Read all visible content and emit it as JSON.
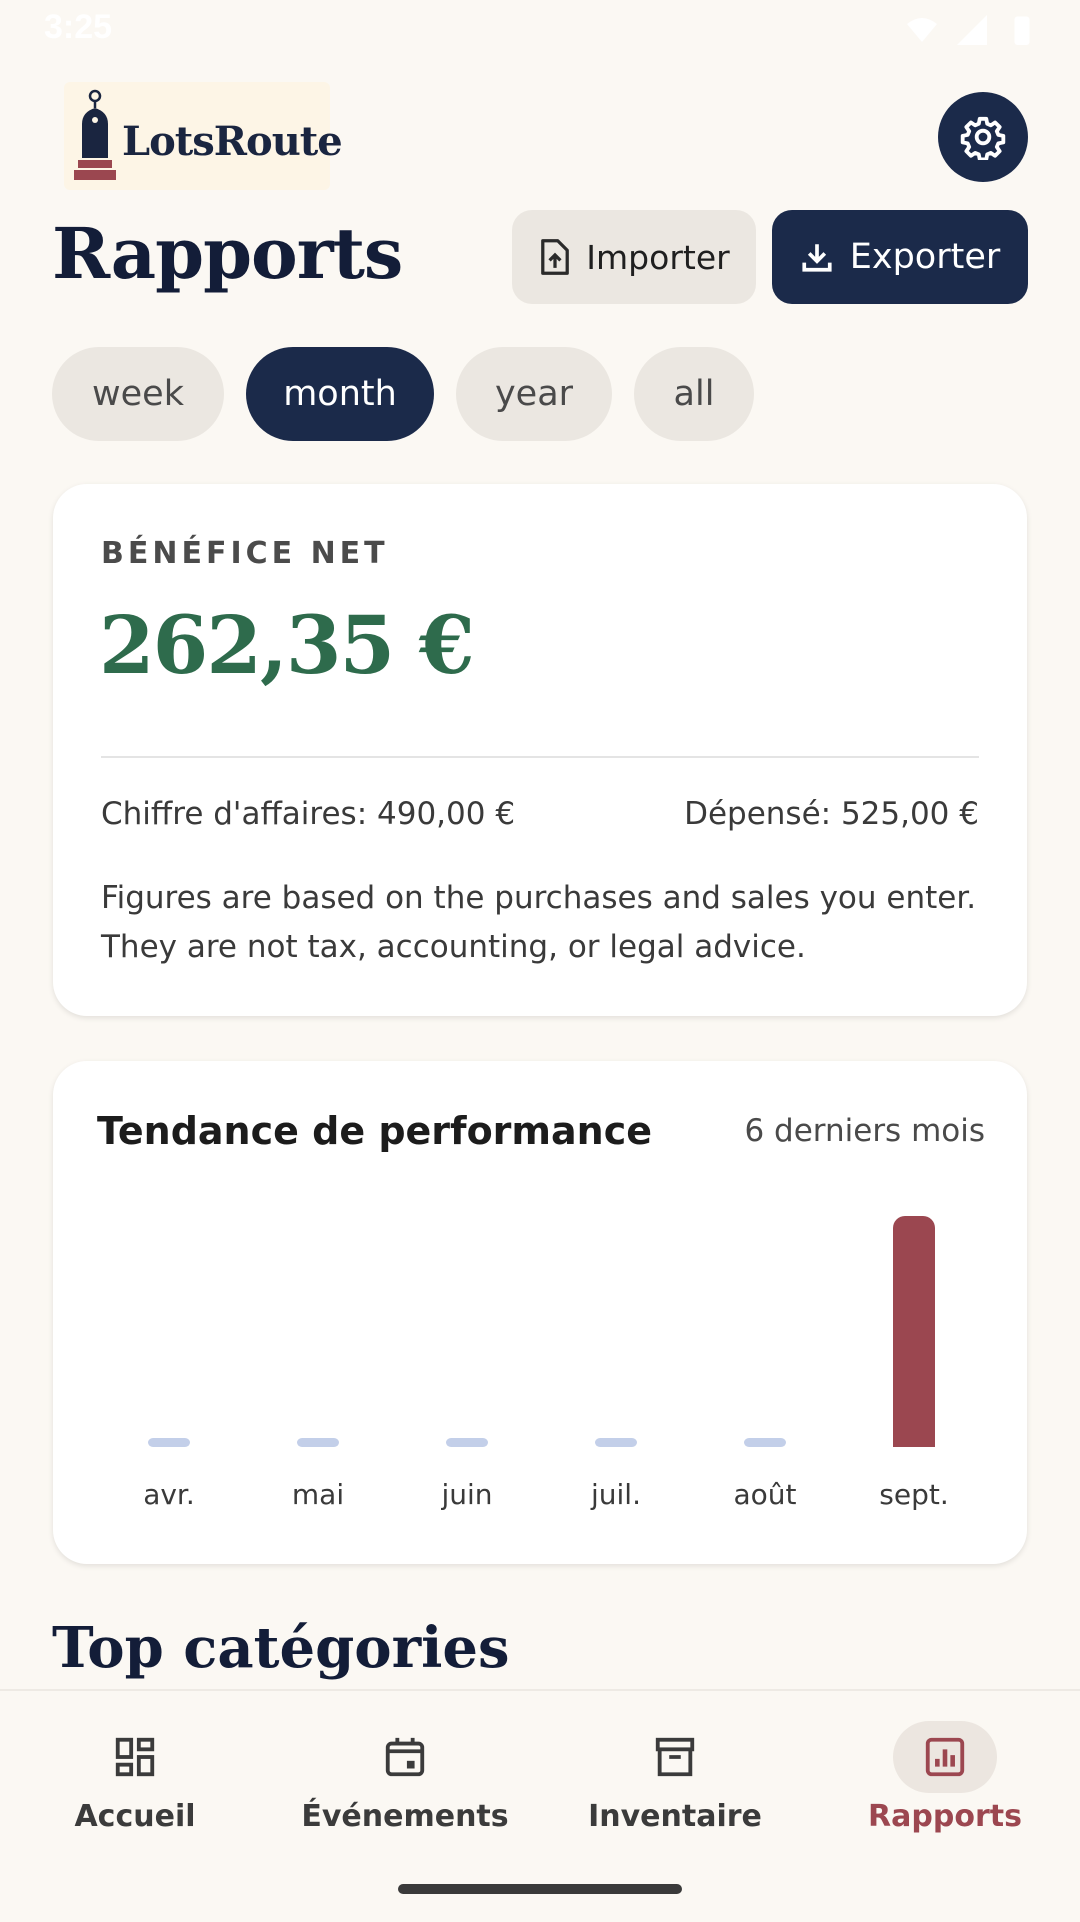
{
  "status_bar": {
    "time": "3:25"
  },
  "app": {
    "logo_text": "LotsRoute"
  },
  "header": {
    "title": "Rapports",
    "import_label": "Importer",
    "export_label": "Exporter"
  },
  "period_filters": [
    {
      "label": "week",
      "active": false
    },
    {
      "label": "month",
      "active": true
    },
    {
      "label": "year",
      "active": false
    },
    {
      "label": "all",
      "active": false
    }
  ],
  "profit_card": {
    "label": "BÉNÉFICE NET",
    "value": "262,35 €",
    "revenue": "Chiffre d'affaires: 490,00 €",
    "spent": "Dépensé: 525,00 €",
    "disclaimer": "Figures are based on the purchases and sales you enter. They are not tax, accounting, or legal advice."
  },
  "trend_card": {
    "title": "Tendance de performance",
    "range": "6 derniers mois"
  },
  "chart_data": {
    "type": "bar",
    "categories": [
      "avr.",
      "mai",
      "juin",
      "juil.",
      "août",
      "sept."
    ],
    "values": [
      0,
      0,
      0,
      0,
      0,
      262.35
    ],
    "colors": {
      "zero": "#c3cfe9",
      "positive": "#9b4750"
    }
  },
  "sections": {
    "top_categories_title": "Top catégories"
  },
  "bottom_nav": [
    {
      "label": "Accueil",
      "icon": "dashboard-icon",
      "active": false
    },
    {
      "label": "Événements",
      "icon": "calendar-icon",
      "active": false
    },
    {
      "label": "Inventaire",
      "icon": "archive-icon",
      "active": false
    },
    {
      "label": "Rapports",
      "icon": "bar-chart-icon",
      "active": true
    }
  ],
  "colors": {
    "navy": "#1b2a4a",
    "profit_green": "#2e6b4c",
    "accent_red": "#9b4750",
    "background": "#fbf8f3"
  }
}
